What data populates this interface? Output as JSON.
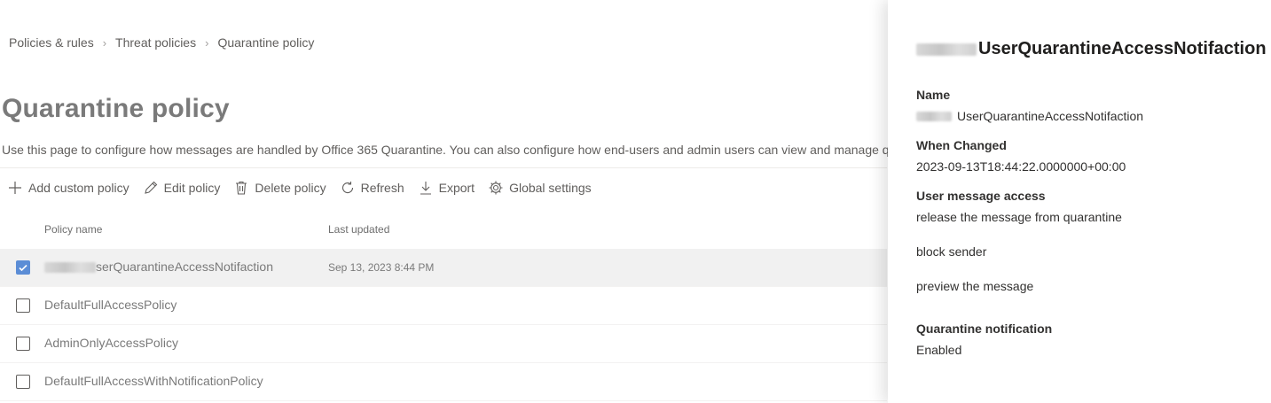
{
  "breadcrumb": {
    "items": [
      "Policies & rules",
      "Threat policies",
      "Quarantine policy"
    ]
  },
  "page": {
    "title": "Quarantine policy",
    "description": "Use this page to configure how messages are handled by Office 365 Quarantine. You can also configure how end-users and admin users can view and manage qua"
  },
  "toolbar": {
    "add_label": "Add custom policy",
    "edit_label": "Edit policy",
    "delete_label": "Delete policy",
    "refresh_label": "Refresh",
    "export_label": "Export",
    "global_label": "Global settings"
  },
  "table": {
    "columns": {
      "name": "Policy name",
      "updated": "Last updated"
    },
    "rows": [
      {
        "name": "serQuarantineAccessNotifaction",
        "updated": "Sep 13, 2023 8:44 PM",
        "selected": true
      },
      {
        "name": "DefaultFullAccessPolicy",
        "updated": "",
        "selected": false
      },
      {
        "name": "AdminOnlyAccessPolicy",
        "updated": "",
        "selected": false
      },
      {
        "name": "DefaultFullAccessWithNotificationPolicy",
        "updated": "",
        "selected": false
      }
    ]
  },
  "flyout": {
    "title": "UserQuarantineAccessNotifaction",
    "name_label": "Name",
    "name_value": "UserQuarantineAccessNotifaction",
    "changed_label": "When Changed",
    "changed_value": "2023-09-13T18:44:22.0000000+00:00",
    "access_label": "User message access",
    "access_items": [
      "release the message from quarantine",
      "block sender",
      "preview the message"
    ],
    "notification_label": "Quarantine notification",
    "notification_value": "Enabled"
  },
  "icons": {
    "add": "plus-icon",
    "edit": "pencil-icon",
    "delete": "trash-icon",
    "refresh": "refresh-icon",
    "export": "download-icon",
    "settings": "gear-icon",
    "check": "checkmark-icon"
  },
  "colors": {
    "accent": "#5b8dd6",
    "selected_row": "#f1f1f1"
  }
}
